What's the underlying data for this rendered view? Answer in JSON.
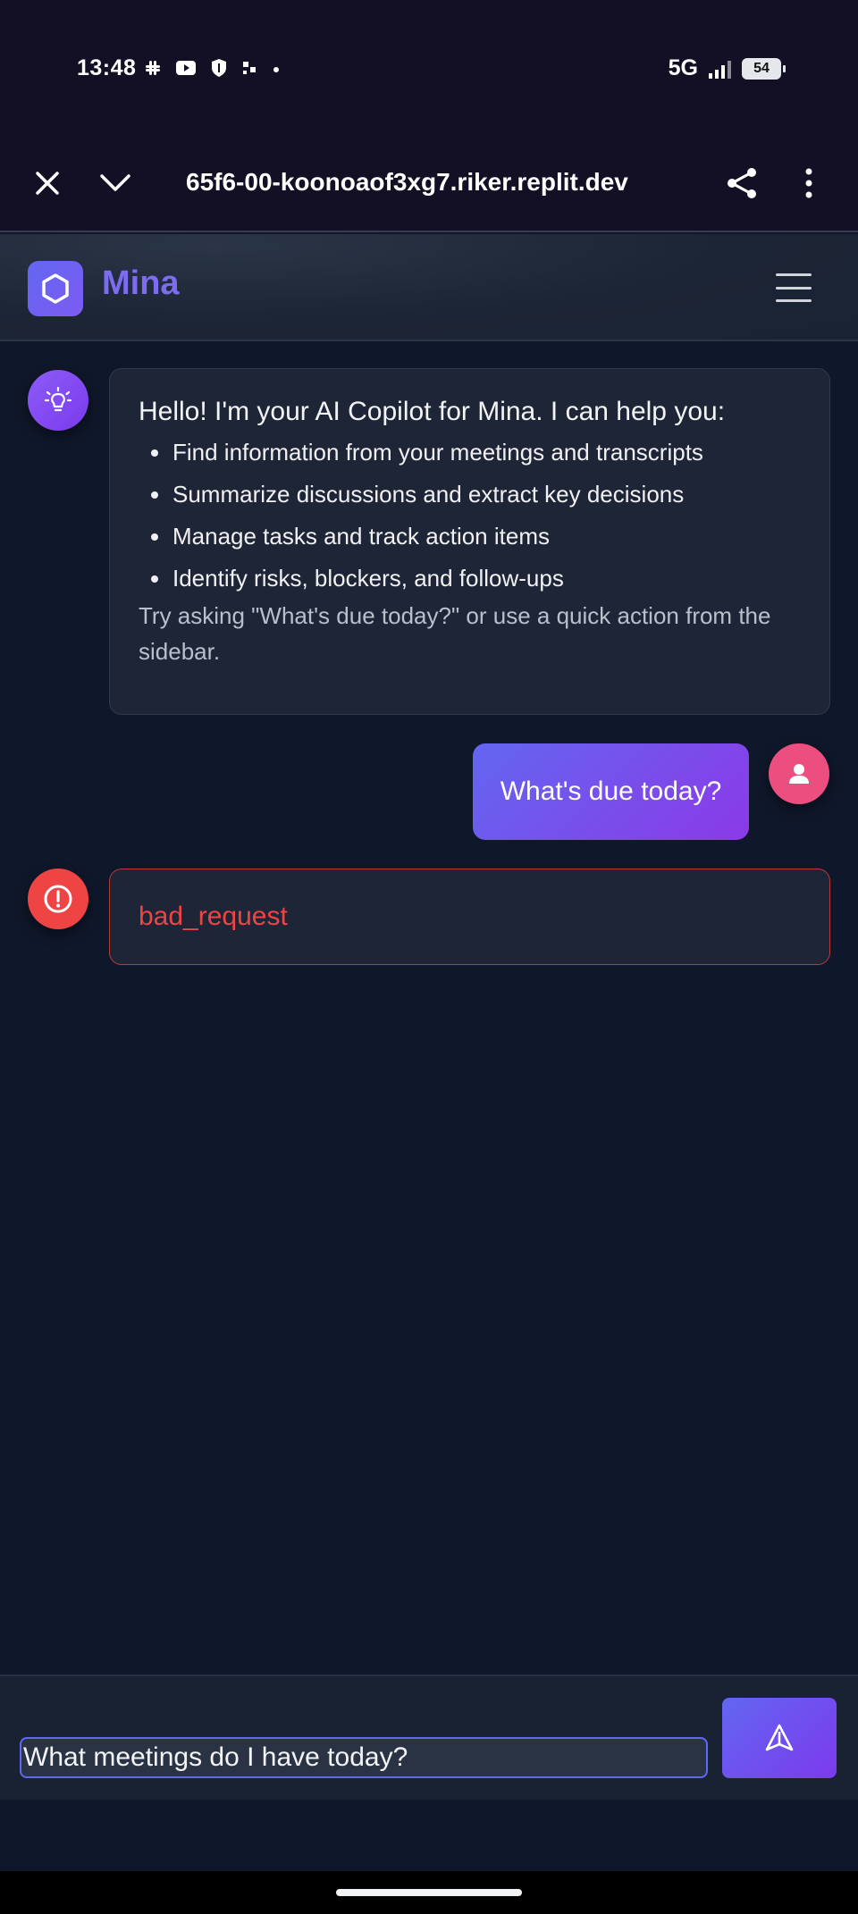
{
  "status_bar": {
    "time": "13:48",
    "network": "5G",
    "battery": "54",
    "notification_icons": [
      "slack-icon",
      "youtube-icon",
      "shield-icon",
      "app-icon",
      "dot-icon"
    ]
  },
  "browser": {
    "url": "65f6-00-koonoaof3xg7.riker.replit.dev"
  },
  "app": {
    "title": "Mina",
    "accent": "#6366f1"
  },
  "chat": {
    "bot_message": {
      "intro": "Hello! I'm your AI Copilot for Mina. I can help you:",
      "items": [
        "Find information from your meetings and transcripts",
        "Summarize discussions and extract key decisions",
        "Manage tasks and track action items",
        "Identify risks, blockers, and follow-ups"
      ],
      "outro": "Try asking \"What's due today?\" or use a quick action from the sidebar."
    },
    "user_message": "What's due today?",
    "error_message": "bad_request"
  },
  "composer": {
    "value": "What meetings do I have today?"
  }
}
